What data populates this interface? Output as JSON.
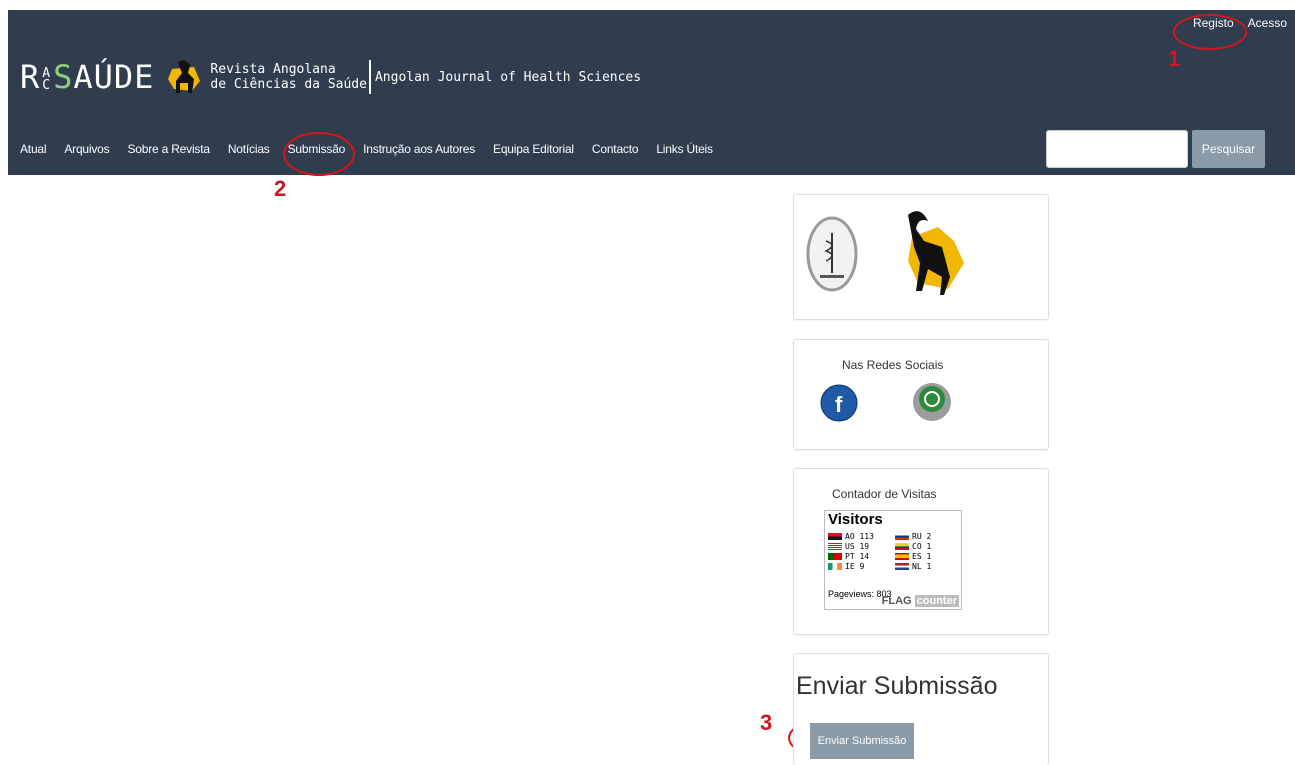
{
  "header": {
    "logo_text": "RACSAÚDE",
    "subtitle_line1": "Revista Angolana",
    "subtitle_line2": "de Ciências da Saúde",
    "english_title": "Angolan Journal of Health Sciences",
    "top_links": [
      "Registo",
      "Acesso"
    ]
  },
  "nav": {
    "items": [
      "Atual",
      "Arquivos",
      "Sobre a Revista",
      "Notícias",
      "Submissão",
      "Instrução aos Autores",
      "Equipa Editorial",
      "Contacto",
      "Links Úteis"
    ]
  },
  "search": {
    "value": "",
    "button_label": "Pesquisar"
  },
  "annotations": [
    "1",
    "2",
    "3"
  ],
  "sidebar": {
    "social": {
      "title": "Nas Redes Sociais",
      "icons": [
        "facebook-icon",
        "whatsapp-icon"
      ]
    },
    "counter": {
      "title": "Contador de Visitas",
      "widget_title": "Visitors",
      "rows": [
        {
          "code": "AO",
          "count": "113"
        },
        {
          "code": "US",
          "count": "19"
        },
        {
          "code": "PT",
          "count": "14"
        },
        {
          "code": "IE",
          "count": "9"
        },
        {
          "code": "RU",
          "count": "2"
        },
        {
          "code": "CO",
          "count": "1"
        },
        {
          "code": "ES",
          "count": "1"
        },
        {
          "code": "NL",
          "count": "1"
        }
      ],
      "pageviews": "Pageviews: 803",
      "brand": "FLAG",
      "brand_suffix": "counter"
    },
    "submission": {
      "heading": "Enviar Submissão",
      "button_label": "Enviar Submissão"
    }
  },
  "colors": {
    "header_bg": "#2f3d4f",
    "accent_green": "#8bd07a",
    "annotation_red": "#d4161b",
    "button_gray": "#8a9aa6"
  }
}
